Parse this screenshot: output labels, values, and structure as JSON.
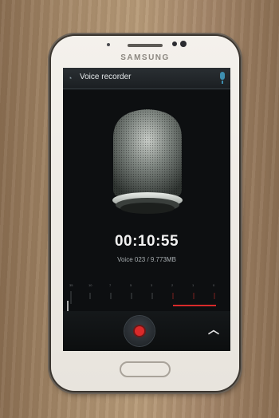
{
  "device": {
    "brand": "SAMSUNG"
  },
  "app": {
    "title": "Voice recorder",
    "icon": "app-icon",
    "status_icon": "microphone-icon"
  },
  "recorder": {
    "elapsed_time": "00:10:55",
    "file_info": "Voice 023 / 9.773MB",
    "meter_labels": [
      "35",
      "10",
      "7",
      "5",
      "3",
      "2",
      "1",
      "0"
    ]
  },
  "controls": {
    "record_icon": "record-icon",
    "expand_icon": "chevron-up-icon"
  },
  "colors": {
    "accent_red": "#d92a2a",
    "mic_blue": "#3e8fb0"
  }
}
